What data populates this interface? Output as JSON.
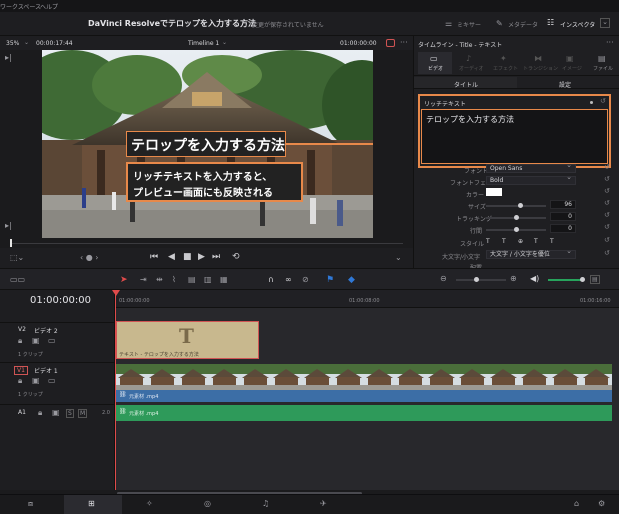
{
  "menu": {
    "workspace": "ワークスペース",
    "help": "ヘルプ"
  },
  "titlebar": {
    "title": "DaVinci Resolveでテロップを入力する方法",
    "status": "変更が保存されていません"
  },
  "top_right": {
    "mixer": "ミキサー",
    "metadata": "メタデータ",
    "inspector": "インスペクタ"
  },
  "viewer": {
    "zoom": "35%",
    "timecode": "00:00:17:44",
    "timeline_name": "Timeline 1",
    "master_tc": "01:00:00:00"
  },
  "overlay": {
    "title": "テロップを入力する方法",
    "callout_line1": "リッチテキストを入力すると、",
    "callout_line2": "プレビュー画面にも反映される"
  },
  "inspector": {
    "header": "タイムライン - Title - テキスト",
    "tabs": [
      "ビデオ",
      "オーディオ",
      "エフェクト",
      "トランジション",
      "イメージ",
      "ファイル"
    ],
    "subtabs": [
      "タイトル",
      "設定"
    ],
    "rich_text_label": "リッチテキスト",
    "rich_text_value": "テロップを入力する方法",
    "props": {
      "font_label": "フォント",
      "font_value": "Open Sans",
      "face_label": "フォントフェイス",
      "face_value": "Bold",
      "color_label": "カラー",
      "size_label": "サイズ",
      "size_value": "96",
      "tracking_label": "トラッキング",
      "tracking_value": "0",
      "line_spacing_label": "行間",
      "line_spacing_value": "0",
      "style_label": "スタイル",
      "case_label": "大文字/小文字",
      "case_value": "大文字 / 小文字を優位",
      "more_label": "配置"
    },
    "style_buttons": [
      "T",
      "T",
      "⊕",
      "T",
      "T"
    ]
  },
  "timeline": {
    "timecode": "01:00:00:00",
    "ruler": [
      "01:00:00:00",
      "01:00:08:00",
      "01:00:16:00"
    ],
    "tracks": {
      "v2": {
        "id": "V2",
        "name": "ビデオ 2",
        "clips": "1 クリップ"
      },
      "v1": {
        "id": "V1",
        "name": "ビデオ 1",
        "clips": "1 クリップ"
      },
      "a1": {
        "id": "A1",
        "level": "2.0",
        "s": "S",
        "m": "M"
      }
    },
    "title_clip_label": "テキスト - テロップを入力する方法",
    "title_clip_glyph": "T",
    "video_clip_label": "元素材 .mp4",
    "audio_clip_label": "元素材 .mp4"
  },
  "icons": {
    "play": "▶",
    "stop": "■",
    "prev": "◀",
    "skip_start": "⏮",
    "skip_end": "⏭",
    "loop": "⟲",
    "speaker": "🔈",
    "home": "⌂",
    "gear": "⚙",
    "link": "🔗",
    "film": "▦"
  }
}
